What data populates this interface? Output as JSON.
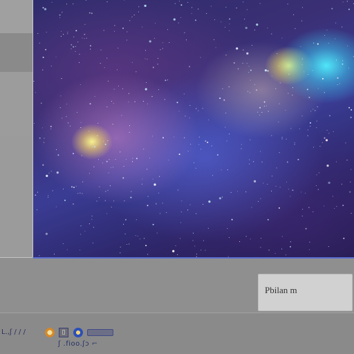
{
  "dialog": {
    "button_label": "Pbilan m"
  },
  "status_bar": {
    "left_text": "L.,ʃ / / /",
    "sub_text": "ʃ .fioo.ʃɔ ⌐"
  },
  "icons": {
    "first": "app-icon",
    "second": "bookmark-icon",
    "third": "browser-icon",
    "fourth": "taskbar-button"
  },
  "colors": {
    "panel": "#8f8f8f",
    "button_bg": "#d1d1d1",
    "accent": "#5a6fd0"
  }
}
